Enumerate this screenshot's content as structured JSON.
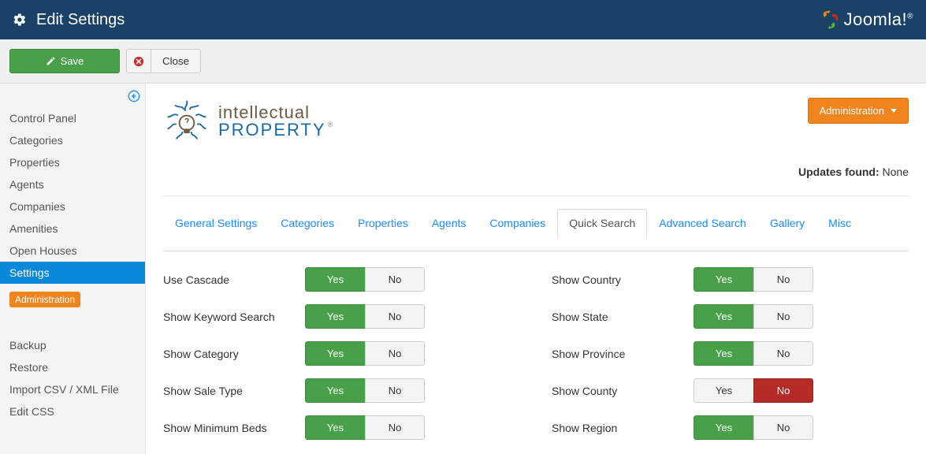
{
  "header": {
    "title": "Edit Settings",
    "brand": "Joomla!"
  },
  "toolbar": {
    "save": "Save",
    "close": "Close"
  },
  "sidebar": {
    "items": [
      {
        "label": "Control Panel"
      },
      {
        "label": "Categories"
      },
      {
        "label": "Properties"
      },
      {
        "label": "Agents"
      },
      {
        "label": "Companies"
      },
      {
        "label": "Amenities"
      },
      {
        "label": "Open Houses"
      },
      {
        "label": "Settings",
        "active": true
      }
    ],
    "badge": "Administration",
    "items2": [
      {
        "label": "Backup"
      },
      {
        "label": "Restore"
      },
      {
        "label": "Import CSV / XML File"
      },
      {
        "label": "Edit CSS"
      }
    ]
  },
  "main": {
    "logo_top": "intellectual",
    "logo_bottom": "PROPERTY",
    "admin_btn": "Administration",
    "updates_label": "Updates found:",
    "updates_value": "None",
    "tabs": [
      {
        "label": "General Settings"
      },
      {
        "label": "Categories"
      },
      {
        "label": "Properties"
      },
      {
        "label": "Agents"
      },
      {
        "label": "Companies"
      },
      {
        "label": "Quick Search",
        "active": true
      },
      {
        "label": "Advanced Search"
      },
      {
        "label": "Gallery"
      },
      {
        "label": "Misc"
      }
    ],
    "yes": "Yes",
    "no": "No",
    "settings_left": [
      {
        "label": "Use Cascade",
        "value": "Yes"
      },
      {
        "label": "Show Keyword Search",
        "value": "Yes"
      },
      {
        "label": "Show Category",
        "value": "Yes"
      },
      {
        "label": "Show Sale Type",
        "value": "Yes"
      },
      {
        "label": "Show Minimum Beds",
        "value": "Yes"
      }
    ],
    "settings_right": [
      {
        "label": "Show Country",
        "value": "Yes"
      },
      {
        "label": "Show State",
        "value": "Yes"
      },
      {
        "label": "Show Province",
        "value": "Yes"
      },
      {
        "label": "Show County",
        "value": "No"
      },
      {
        "label": "Show Region",
        "value": "Yes"
      }
    ]
  }
}
